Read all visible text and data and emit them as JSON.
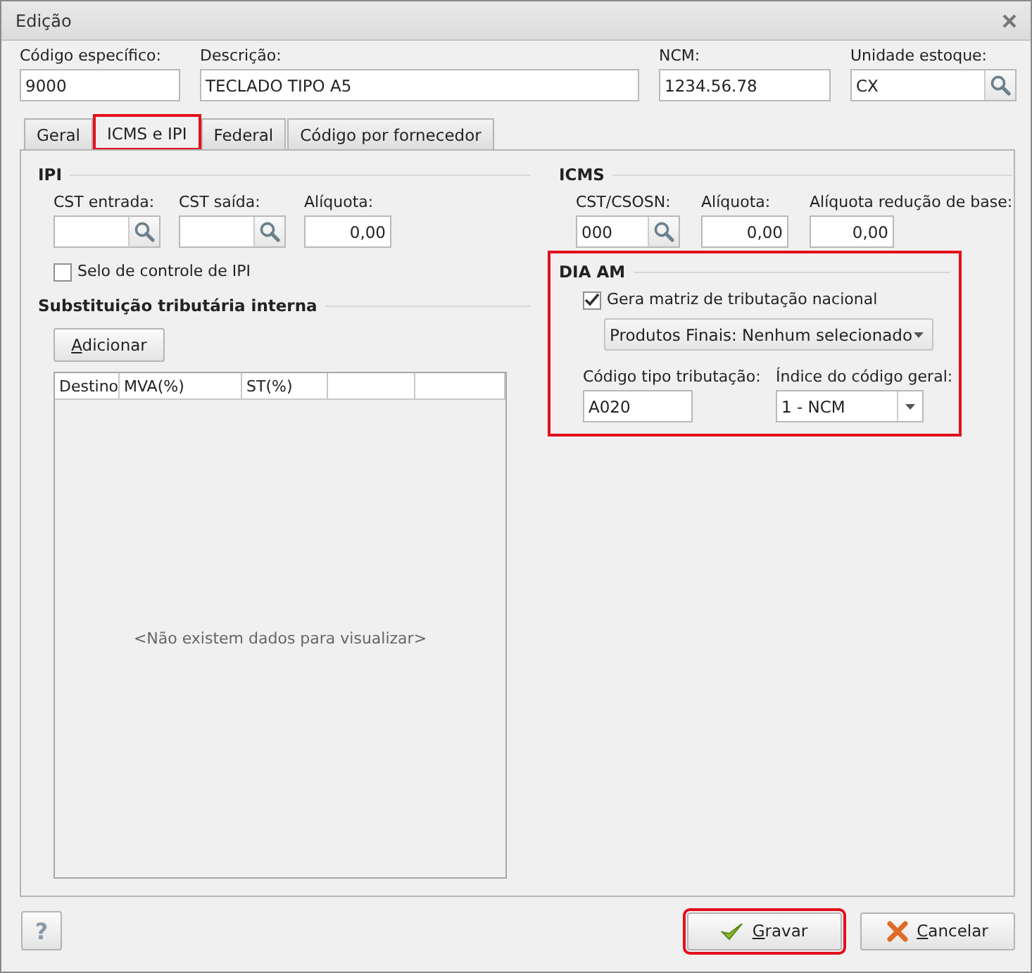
{
  "window": {
    "title": "Edição"
  },
  "header_fields": [
    {
      "label": "Código específico:",
      "value": "9000",
      "kind": "text"
    },
    {
      "label": "Descrição:",
      "value": "TECLADO TIPO A5",
      "kind": "text"
    },
    {
      "label": "NCM:",
      "value": "1234.56.78",
      "kind": "text"
    },
    {
      "label": "Unidade estoque:",
      "value": "CX",
      "kind": "search"
    }
  ],
  "tabs": [
    {
      "label": "Geral",
      "selected": false,
      "highlighted": false
    },
    {
      "label": "ICMS e IPI",
      "selected": true,
      "highlighted": true
    },
    {
      "label": "Federal",
      "selected": false,
      "highlighted": false
    },
    {
      "label": "Código por fornecedor",
      "selected": false,
      "highlighted": false
    }
  ],
  "ipi": {
    "title": "IPI",
    "fields": [
      {
        "label": "CST entrada:",
        "kind": "search"
      },
      {
        "label": "CST saída:",
        "kind": "search"
      },
      {
        "label": "Alíquota:",
        "value": "0,00",
        "kind": "number"
      }
    ],
    "checkbox": {
      "label": "Selo de controle de IPI",
      "checked": false
    }
  },
  "substitution": {
    "title": "Substituição tributária interna",
    "add_button": {
      "label": "Adicionar",
      "underline_first": true
    },
    "table": {
      "columns": [
        "Destino",
        "MVA(%)",
        "ST(%)"
      ],
      "empty_message": "<Não existem dados para visualizar>"
    }
  },
  "icms": {
    "title": "ICMS",
    "fields": [
      {
        "label": "CST/CSOSN:",
        "value": "000",
        "kind": "search"
      },
      {
        "label": "Alíquota:",
        "value": "0,00",
        "kind": "number"
      },
      {
        "label": "Alíquota redução de base:",
        "value": "0,00",
        "kind": "number"
      }
    ]
  },
  "dia_am": {
    "title": "DIA AM",
    "highlighted": true,
    "checkbox": {
      "label": "Gera matriz de tributação nacional",
      "checked": true
    },
    "products_dropdown": {
      "value": "Produtos Finais: Nenhum selecionado"
    },
    "code_field": {
      "label": "Código tipo tributação:",
      "value": "A020"
    },
    "index_combo": {
      "label": "Índice do código geral:",
      "value": "1 - NCM"
    }
  },
  "buttons": [
    {
      "label": "?",
      "kind": "help",
      "highlighted": false,
      "underline_first": false
    },
    {
      "label": "Gravar",
      "kind": "save",
      "highlighted": true,
      "underline_first": true
    },
    {
      "label": "Cancelar",
      "kind": "cancel",
      "highlighted": false,
      "underline_first": true
    }
  ]
}
